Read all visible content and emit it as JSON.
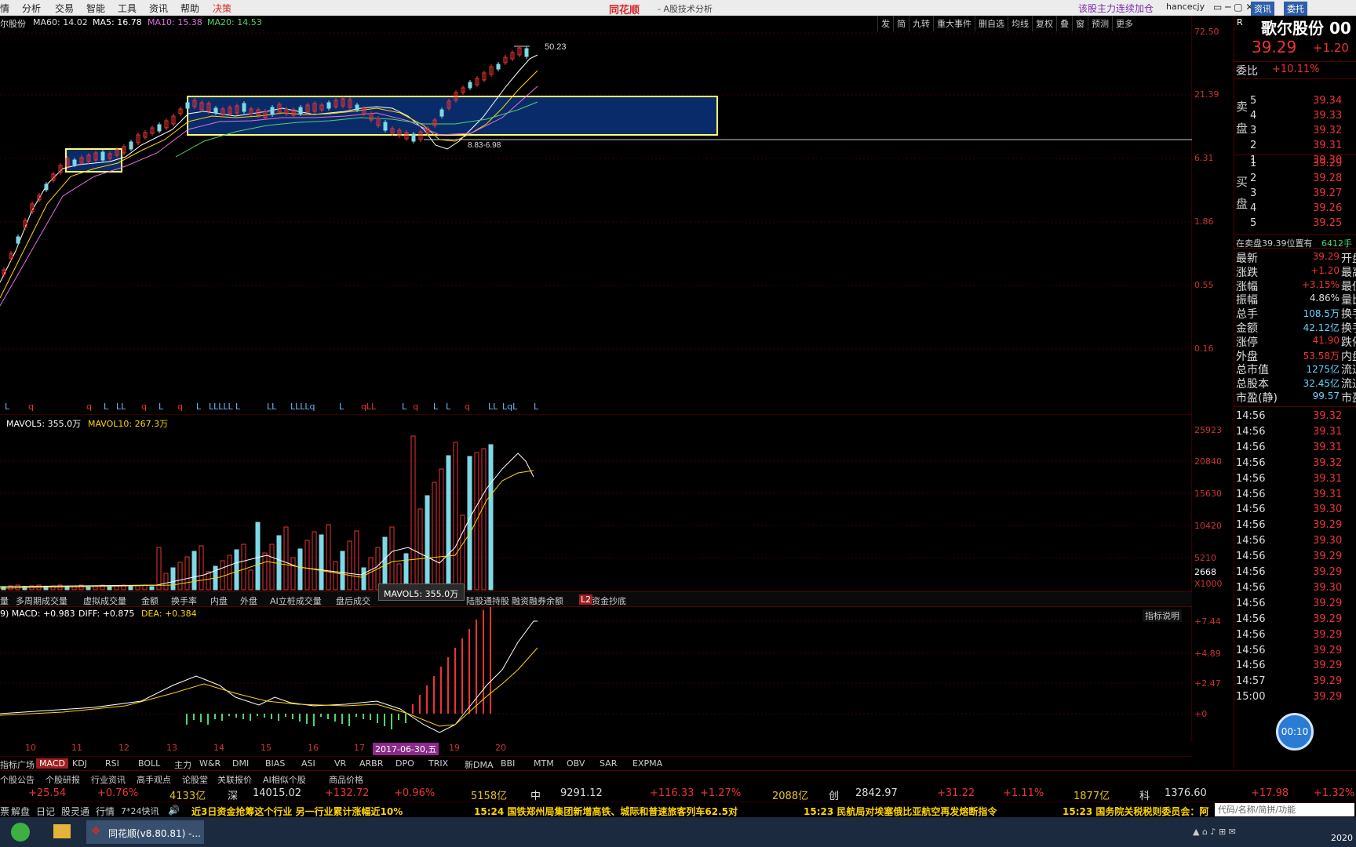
{
  "menu": {
    "items": [
      "情",
      "分析",
      "交易",
      "智能",
      "工具",
      "资讯",
      "帮助",
      "决策"
    ],
    "app_title": "同花顺",
    "subtitle": "- A股技术分析",
    "promo": "该股主力连续加仓",
    "user": "hancecjy"
  },
  "kline": {
    "stock_label": "尔股份",
    "ma60": "MA60: 14.02",
    "ma5": "MA5: 16.78",
    "ma10": "MA10: 15.38",
    "ma20": "MA20: 14.53",
    "high_label": "50.23",
    "range_label": "8.83-6.98",
    "y_ticks": [
      "72.50",
      "21.39",
      "6.31",
      "1.86",
      "0.55",
      "0.16"
    ]
  },
  "toolbar": [
    "发",
    "简",
    "九转",
    "重大事件",
    "删自选",
    "均线",
    "复权",
    "叠",
    "窗",
    "预测",
    "更多"
  ],
  "volume": {
    "label_ma5": "MAVOL5: 355.0万",
    "label_ma10": "MAVOL10: 267.3万",
    "y_ticks": [
      "25923",
      "20840",
      "15630",
      "10420",
      "5210",
      "2668",
      "X1000"
    ],
    "tooltip": "MAVOL5: 355.0万"
  },
  "vol_tabs": [
    "量",
    "多周期成交量",
    "虚拟成交量",
    "金额",
    "换手率",
    "内盘",
    "外盘",
    "AI立桩成交量",
    "盘后成交",
    "陆股通持股",
    "融资融券余额",
    "资金抄底"
  ],
  "macd": {
    "label": "9) MACD: +0.983",
    "diff": "DIFF: +0.875",
    "dea": "DEA: +0.384",
    "help": "指标说明",
    "y_ticks": [
      "+7.44",
      "+4.89",
      "+2.47",
      "+0"
    ]
  },
  "dates": [
    "10",
    "11",
    "12",
    "13",
    "14",
    "15",
    "16",
    "17",
    "2017-06-30,五",
    "19",
    "20"
  ],
  "ind_tabs": [
    "指标广场",
    "MACD",
    "KDJ",
    "RSI",
    "BOLL",
    "主力",
    "W&R",
    "DMI",
    "BIAS",
    "ASI",
    "VR",
    "ARBR",
    "DPO",
    "TRIX",
    "新DMA",
    "BBI",
    "MTM",
    "OBV",
    "SAR",
    "EXPMA"
  ],
  "quote": {
    "name": "歌尔股份 00",
    "price": "39.29",
    "change": "+1.20",
    "weibi_label": "委比",
    "weibi": "+10.11%",
    "sell_label": "卖盘",
    "buy_label": "买盘",
    "asks": [
      [
        "5",
        "39.34"
      ],
      [
        "4",
        "39.33"
      ],
      [
        "3",
        "39.32"
      ],
      [
        "2",
        "39.31"
      ],
      [
        "1",
        "39.30"
      ]
    ],
    "bids": [
      [
        "1",
        "39.29"
      ],
      [
        "2",
        "39.28"
      ],
      [
        "3",
        "39.27"
      ],
      [
        "4",
        "39.26"
      ],
      [
        "5",
        "39.25"
      ]
    ],
    "position": "在卖盘39.39位置有",
    "position_vol": "6412手",
    "stats": [
      [
        "最新",
        "39.29",
        "开盘"
      ],
      [
        "涨跌",
        "+1.20",
        "最高"
      ],
      [
        "涨幅",
        "+3.15%",
        "最低"
      ],
      [
        "振幅",
        "4.86%",
        "量比"
      ],
      [
        "总手",
        "108.5万",
        "换手"
      ],
      [
        "金额",
        "42.12亿",
        "换手"
      ],
      [
        "涨停",
        "41.90",
        "跌停"
      ],
      [
        "外盘",
        "53.58万",
        "内盘"
      ],
      [
        "总市值",
        "1275亿",
        "流通"
      ],
      [
        "总股本",
        "32.45亿",
        "流通"
      ],
      [
        "市盈(静)",
        "99.57",
        "市盈"
      ]
    ],
    "ticks": [
      [
        "14:56",
        "39.32"
      ],
      [
        "14:56",
        "39.31"
      ],
      [
        "14:56",
        "39.31"
      ],
      [
        "14:56",
        "39.32"
      ],
      [
        "14:56",
        "39.31"
      ],
      [
        "14:56",
        "39.31"
      ],
      [
        "14:56",
        "39.30"
      ],
      [
        "14:56",
        "39.29"
      ],
      [
        "14:56",
        "39.30"
      ],
      [
        "14:56",
        "39.29"
      ],
      [
        "14:56",
        "39.29"
      ],
      [
        "14:56",
        "39.30"
      ],
      [
        "14:56",
        "39.29"
      ],
      [
        "14:56",
        "39.29"
      ],
      [
        "14:56",
        "39.29"
      ],
      [
        "14:56",
        "39.29"
      ],
      [
        "14:56",
        "39.29"
      ],
      [
        "14:57",
        "39.29"
      ],
      [
        "15:00",
        "39.29"
      ]
    ],
    "tabs": [
      "细",
      "诊",
      "分",
      "筹",
      "焰",
      "指"
    ],
    "news_btn": "资讯",
    "widget_btn": "委托"
  },
  "bottom_tabs": [
    "个股公告",
    "个股研报",
    "行业资讯",
    "高手观点",
    "论股堂",
    "关联报价",
    "AI相似个股",
    "商品价格"
  ],
  "ticker": [
    "+25.54",
    "+0.76%",
    "4133亿",
    "深",
    "14015.02",
    "+132.72",
    "+0.96%",
    "5158亿",
    "中",
    "9291.12",
    "+116.33",
    "+1.27%",
    "2088亿",
    "创",
    "2842.97",
    "+31.22",
    "+1.11%",
    "1877亿",
    "科",
    "1376.60",
    "+17.98",
    "+1.32%"
  ],
  "news_bar": {
    "items": [
      "票",
      "解盘",
      "日记",
      "股灵通",
      "行情",
      "7*24快讯"
    ],
    "headlines": [
      "近3日资金抢筹这个行业 另一行业累计涨幅近10%",
      "15:24 国铁郑州局集团新增高铁、城际和普速旅客列车62.5对",
      "15:23 民航局对埃塞俄比亚航空再发熔断指令",
      "15:23 国务院关税税则委员会：阿"
    ],
    "search": "代码/名称/简拼/功能"
  },
  "taskbar": {
    "app": "同花顺(v8.80.81) -...",
    "time": "2020"
  },
  "timer": "00:10",
  "colors": {
    "up": "#e33",
    "down": "#7fd8e6",
    "box": "#ffff66",
    "box_fill": "#0a2b6a"
  }
}
